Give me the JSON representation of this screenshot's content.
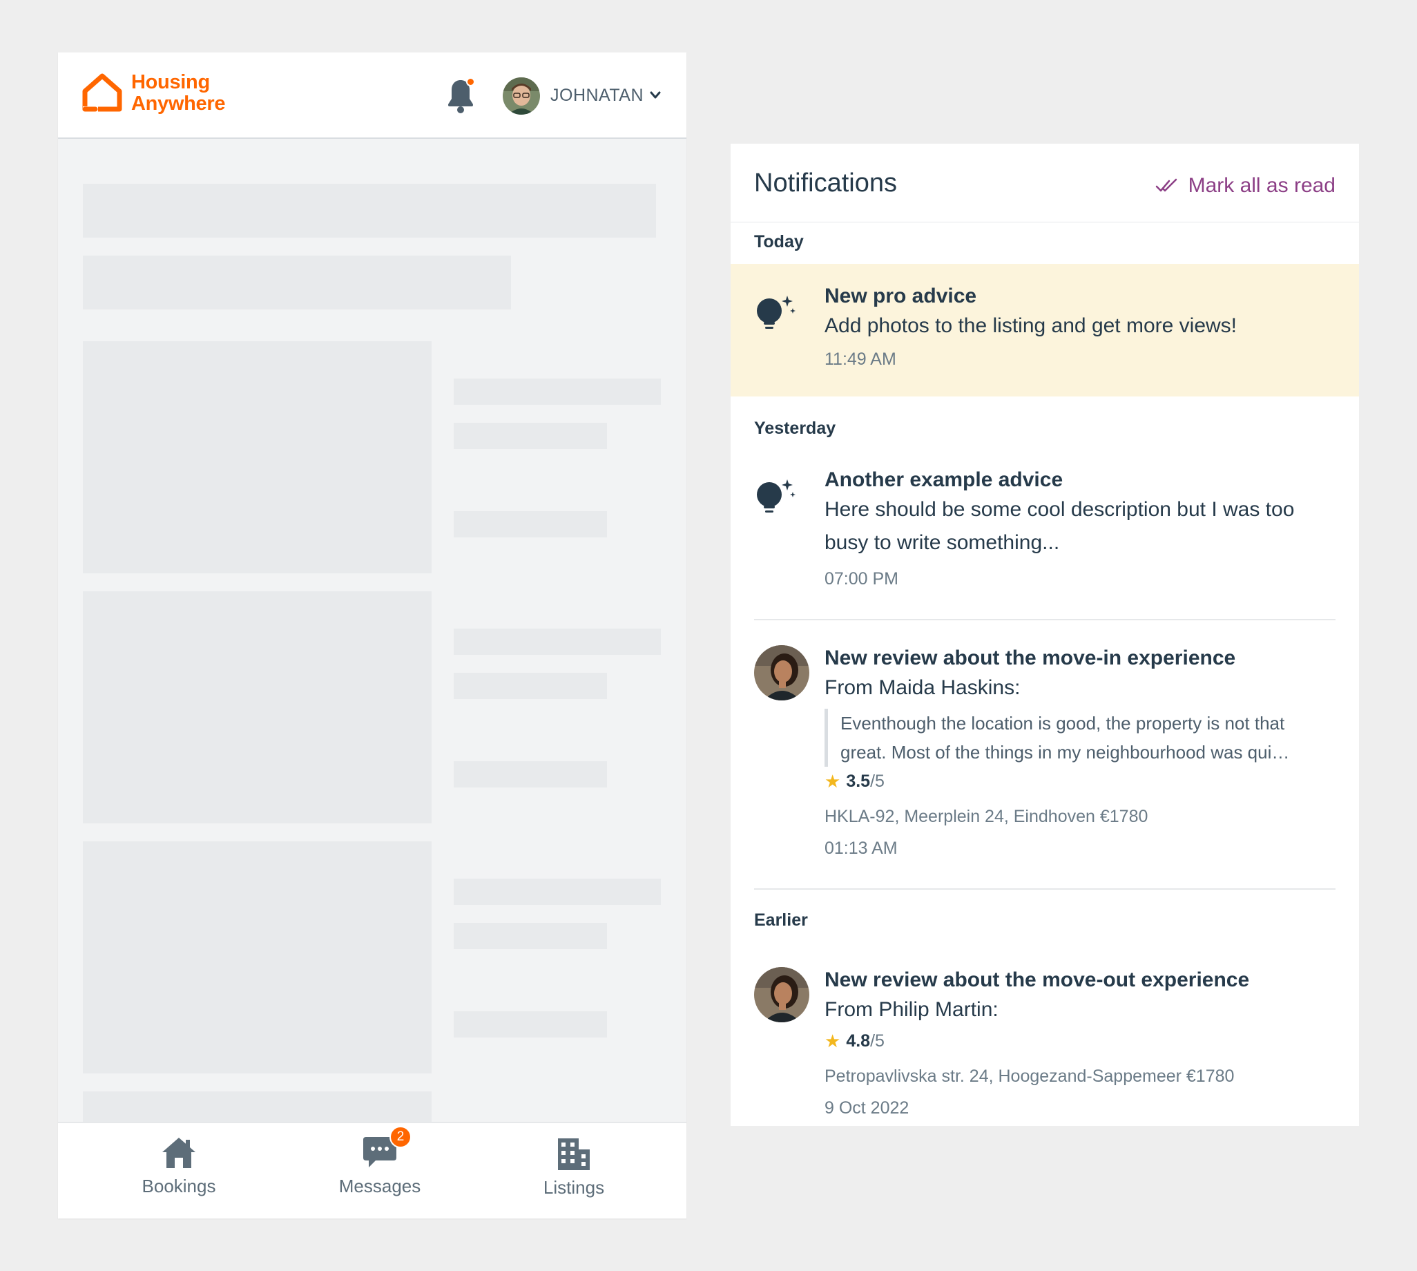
{
  "app": {
    "logo_line1": "Housing",
    "logo_line2": "Anywhere",
    "brand_color": "#ff6600",
    "user_name": "JOHNATAN"
  },
  "bottom_nav": {
    "bookings": "Bookings",
    "messages": "Messages",
    "messages_badge": "2",
    "listings": "Listings"
  },
  "notifications": {
    "title": "Notifications",
    "mark_all": "Mark all as read",
    "accent_color": "#8c3f86",
    "highlight_color": "#fcf4dc",
    "sections": {
      "today": "Today",
      "yesterday": "Yesterday",
      "earlier": "Earlier"
    },
    "items": [
      {
        "title": "New pro advice",
        "body": "Add photos to the listing and get more views!",
        "time": "11:49 AM",
        "icon": "lightbulb-icon",
        "unread": true
      },
      {
        "title": "Another example advice",
        "body": "Here should be some cool description but I was too busy to write something...",
        "time": "07:00 PM",
        "icon": "lightbulb-icon"
      },
      {
        "title": "New review about the move-in experience",
        "body": "From Maida Haskins:",
        "quote": "Eventhough the location is good, the property is not that great. Most of the things in my neighbourhood was qui…",
        "rating": "3.5",
        "rating_max": "/5",
        "listing": "HKLA-92, Meerplein 24, Eindhoven €1780",
        "time": "01:13 AM"
      },
      {
        "title": "New review about the move-out experience",
        "body": "From Philip Martin:",
        "rating": "4.8",
        "rating_max": "/5",
        "listing": "Petropavlivska str. 24, Hoogezand-Sappemeer €1780",
        "time": "9 Oct 2022"
      }
    ]
  }
}
